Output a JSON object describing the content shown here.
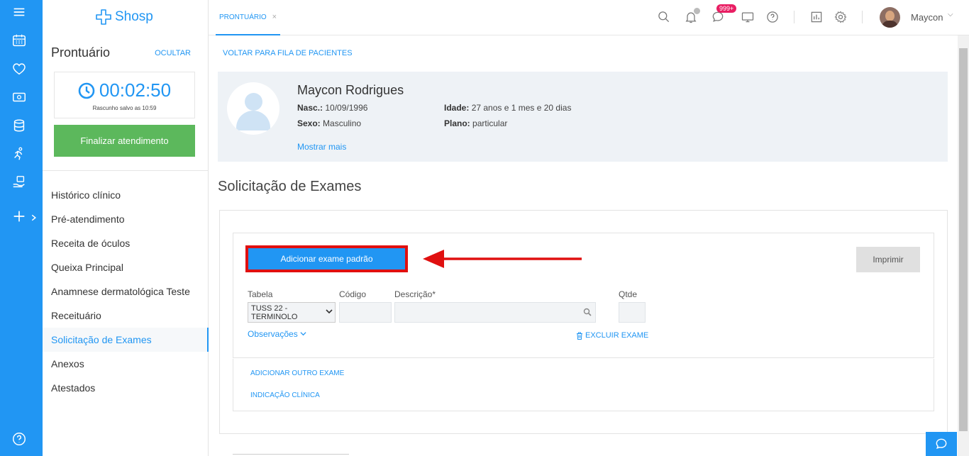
{
  "brand": {
    "logo_text": "Shosp",
    "color": "#2196f3"
  },
  "rail": {
    "icons": [
      "menu-icon",
      "calendar-icon",
      "heart-icon",
      "money-icon",
      "database-icon",
      "runner-icon",
      "hand-money-icon",
      "plus-icon",
      "help-icon"
    ]
  },
  "panel": {
    "title": "Prontuário",
    "hide_label": "OCULTAR",
    "timer": "00:02:50",
    "draft_text": "Rascunho salvo as 10:59",
    "finish_label": "Finalizar atendimento",
    "menu": [
      {
        "label": "Histórico clínico"
      },
      {
        "label": "Pré-atendimento"
      },
      {
        "label": "Receita de óculos"
      },
      {
        "label": "Queixa Principal"
      },
      {
        "label": "Anamnese dermatológica Teste"
      },
      {
        "label": "Receituário"
      },
      {
        "label": "Solicitação de Exames"
      },
      {
        "label": "Anexos"
      },
      {
        "label": "Atestados"
      }
    ]
  },
  "topbar": {
    "tab_label": "PRONTUÁRIO",
    "tab_close": "×",
    "badge": "999+",
    "user_name": "Maycon"
  },
  "main": {
    "back_label": "VOLTAR PARA FILA DE PACIENTES",
    "patient": {
      "name": "Maycon Rodrigues",
      "birth_label": "Nasc.:",
      "birth": "10/09/1996",
      "sex_label": "Sexo:",
      "sex": "Masculino",
      "age_label": "Idade:",
      "age": "27 anos e 1 mes e 20 dias",
      "plan_label": "Plano:",
      "plan": "particular",
      "more_label": "Mostrar mais"
    },
    "section_title": "Solicitação de Exames",
    "add_default_label": "Adicionar exame padrão",
    "print_label": "Imprimir",
    "fields": {
      "table_label": "Tabela",
      "table_value": "TUSS 22 - TERMINOLO",
      "code_label": "Código",
      "desc_label": "Descrição*",
      "qty_label": "Qtde"
    },
    "observations_label": "Observações",
    "delete_label": "EXCLUIR EXAME",
    "add_other_label": "ADICIONAR OUTRO EXAME",
    "clinical_label": "INDICAÇÃO CLÍNICA"
  }
}
